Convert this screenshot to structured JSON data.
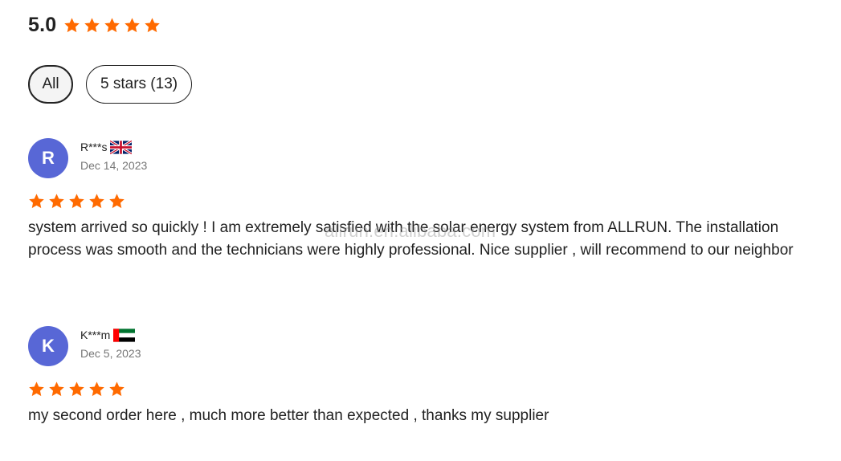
{
  "summary": {
    "score": "5.0",
    "stars": 5
  },
  "filters": [
    {
      "label": "All",
      "active": true
    },
    {
      "label": "5 stars (13)",
      "active": false
    }
  ],
  "reviews": [
    {
      "avatar_initial": "R",
      "name": "R***s",
      "flag": "uk-flag-icon",
      "date": "Dec 14, 2023",
      "stars": 5,
      "text": "system arrived so quickly ! I am extremely satisfied with the solar energy system from ALLRUN. The installation process was smooth and the technicians were highly professional. Nice supplier , will recommend to our neighbor"
    },
    {
      "avatar_initial": "K",
      "name": "K***m",
      "flag": "uae-flag-icon",
      "date": "Dec 5, 2023",
      "stars": 5,
      "text": "my second order here , much more better than expected , thanks my supplier"
    }
  ],
  "watermark": "allrun.en.alibaba.com",
  "colors": {
    "star": "#ff6a00",
    "avatar": "#5867d6",
    "date": "#767676"
  }
}
